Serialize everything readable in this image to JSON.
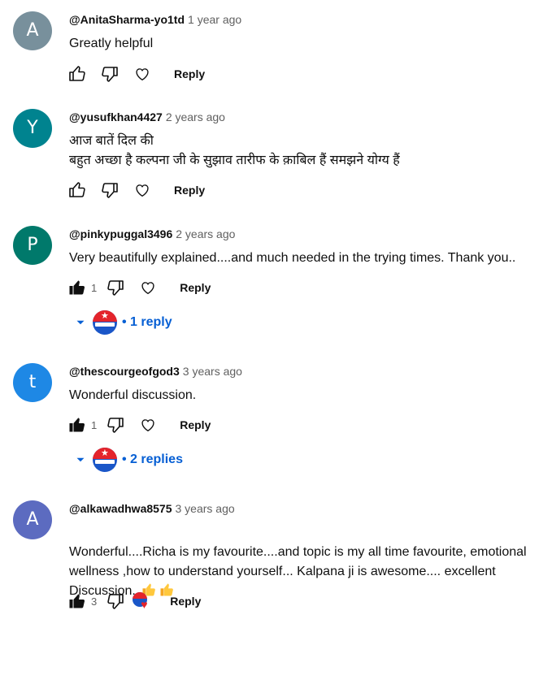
{
  "comments": [
    {
      "initial": "A",
      "avatar_color": "#78909c",
      "author": "@AnitaSharma-yo1td",
      "time": "1 year ago",
      "text": "Greatly helpful",
      "like_count": "",
      "reply_label": "Reply"
    },
    {
      "initial": "Y",
      "avatar_color": "#00838f",
      "author": "@yusufkhan4427",
      "time": "2 years ago",
      "text": "आज बातें दिल की\nबहुत  अच्छा है    कल्पना जी के सुझाव  तारीफ के क़ाबिल हैं  समझने योग्य हैं",
      "like_count": "",
      "reply_label": "Reply"
    },
    {
      "initial": "P",
      "avatar_color": "#00796b",
      "author": "@pinkypuggal3496",
      "time": "2 years ago",
      "text": "Very beautifully explained....and much needed in the trying times. Thank you..",
      "like_count": "1",
      "reply_label": "Reply",
      "replies_label": "1 reply"
    },
    {
      "initial": "t",
      "avatar_color": "#1e88e5",
      "author": "@thescourgeofgod3",
      "time": "3 years ago",
      "text": "Wonderful discussion.",
      "like_count": "1",
      "reply_label": "Reply",
      "replies_label": "2 replies"
    },
    {
      "initial": "A",
      "avatar_color": "#5c6bc0",
      "author": "@alkawadhwa8575",
      "time": "3 years ago",
      "text": "Wonderful....Richa is my favourite....and topic is my all time favourite, emotional wellness ,how to understand yourself... Kalpana ji is awesome.... excellent Discussion..",
      "like_count": "3",
      "reply_label": "Reply"
    }
  ],
  "icons": {
    "like": "thumb-up-outline-icon",
    "like_filled": "thumb-up-filled-icon",
    "dislike": "thumb-down-outline-icon",
    "heart": "heart-outline-icon",
    "expand": "caret-down-icon"
  },
  "colors": {
    "link_blue": "#065fd4",
    "creator_red": "#e4242b",
    "creator_blue": "#1a56c8"
  }
}
